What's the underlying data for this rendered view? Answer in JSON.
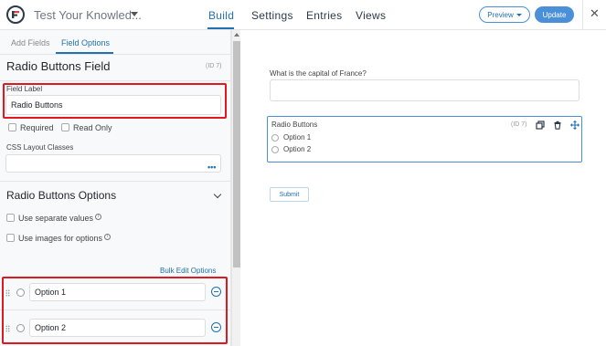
{
  "topbar": {
    "form_title": "Test Your Knowled...",
    "nav_tabs": [
      "Build",
      "Settings",
      "Entries",
      "Views"
    ],
    "preview_label": "Preview",
    "update_label": "Update",
    "close_glyph": "✕"
  },
  "sidebar": {
    "tabs": [
      "Add Fields",
      "Field Options"
    ],
    "field_heading": "Radio Buttons Field",
    "field_id": "(ID 7)",
    "field_label_caption": "Field Label",
    "field_label_value": "Radio Buttons",
    "required_label": "Required",
    "read_only_label": "Read Only",
    "css_caption": "CSS Layout Classes",
    "css_value": "",
    "more_glyph": "•••",
    "options_heading": "Radio Buttons Options",
    "separate_values_label": "Use separate values",
    "images_label": "Use images for options",
    "info_glyph": "i",
    "bulk_edit_label": "Bulk Edit Options",
    "options": [
      "Option 1",
      "Option 2"
    ]
  },
  "canvas": {
    "question_label": "What is the capital of France?",
    "question_value": "",
    "radio_field": {
      "title": "Radio Buttons",
      "id": "(ID 7)",
      "options": [
        "Option 1",
        "Option 2"
      ]
    },
    "submit_label": "Submit"
  },
  "colors": {
    "accent": "#2271b1",
    "highlight": "#e0181f",
    "field_border": "#4a90d9"
  }
}
